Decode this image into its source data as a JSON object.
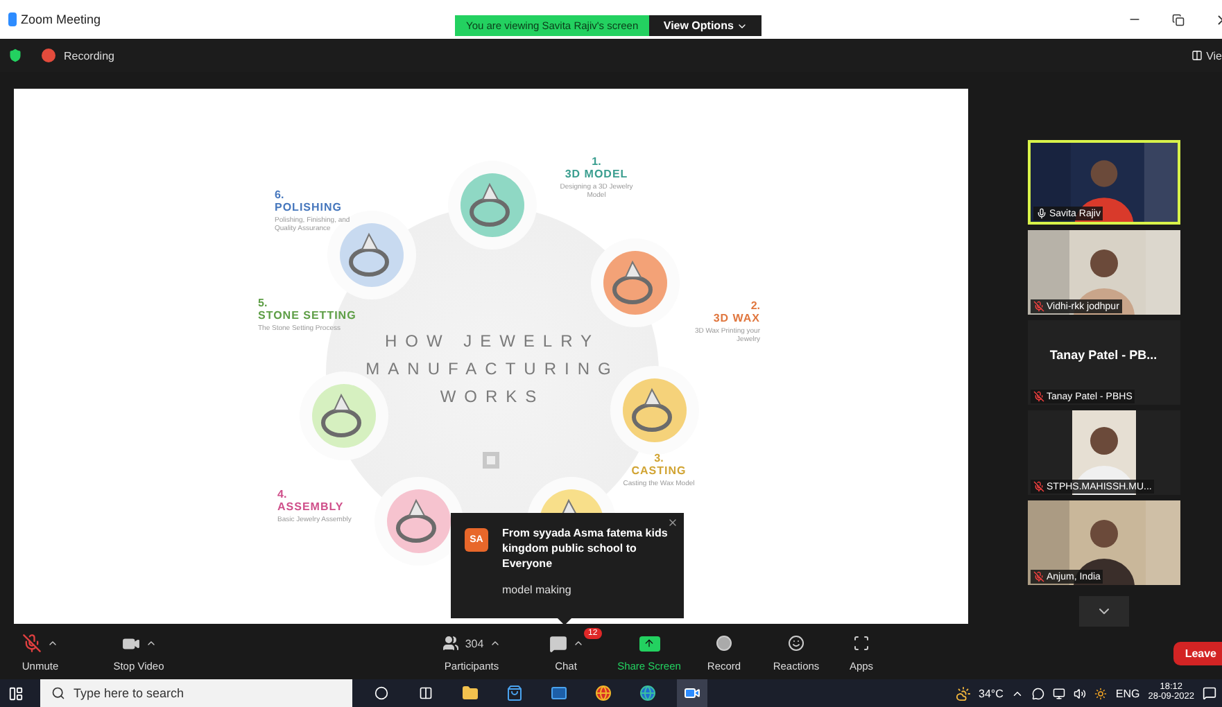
{
  "window": {
    "title": "Zoom Meeting",
    "share_banner": "You are viewing Savita Rajiv's screen",
    "view_options": "View Options"
  },
  "top_bar": {
    "recording": "Recording",
    "view": "Vie"
  },
  "slide": {
    "title_lines": [
      "HOW JEWELRY",
      "MANUFACTURING",
      "WORKS"
    ],
    "steps": [
      {
        "number": "1.",
        "name": "3D MODEL",
        "description": "Designing a 3D Jewelry Model",
        "color": "#3a9e8f"
      },
      {
        "number": "6.",
        "name": "POLISHING",
        "description": "Polishing, Finishing, and Quality Assurance",
        "color": "#4677bd"
      },
      {
        "number": "5.",
        "name": "STONE SETTING",
        "description": "The Stone Setting Process",
        "color": "#5e9e46"
      },
      {
        "number": "2.",
        "name": "3D WAX",
        "description": "3D Wax Printing your Jewelry",
        "color": "#e0763e"
      },
      {
        "number": "3.",
        "name": "CASTING",
        "description": "Casting the Wax Model",
        "color": "#d1a433"
      },
      {
        "number": "4.",
        "name": "ASSEMBLY",
        "description": "Basic Jewelry Assembly",
        "color": "#cf4f8a"
      }
    ]
  },
  "participants": [
    {
      "name": "Savita Rajiv",
      "kind": "video",
      "selected": true,
      "muted": false
    },
    {
      "name": "Vidhi-rkk jodhpur",
      "kind": "video",
      "selected": false,
      "muted": true
    },
    {
      "name": "Tanay Patel - PBHS",
      "title": "Tanay Patel - PB...",
      "kind": "name_only",
      "selected": false,
      "muted": true
    },
    {
      "name": "STPHS.MAHISSH.MU...",
      "kind": "video",
      "selected": false,
      "muted": true
    },
    {
      "name": "Anjum, India",
      "kind": "video",
      "selected": false,
      "muted": true
    }
  ],
  "chat_popup": {
    "avatar": "SA",
    "sender": "From syyada Asma fatema kids kingdom public school to Everyone",
    "message": "model making"
  },
  "toolbar": {
    "audio": {
      "label": "Unmute",
      "muted": true
    },
    "video": {
      "label": "Stop Video"
    },
    "participants": {
      "label": "Participants",
      "count": "304"
    },
    "chat": {
      "label": "Chat",
      "badge": "12"
    },
    "share": {
      "label": "Share Screen"
    },
    "record": {
      "label": "Record"
    },
    "reactions": {
      "label": "Reactions"
    },
    "apps": {
      "label": "Apps"
    },
    "leave": {
      "label": "Leave"
    }
  },
  "taskbar": {
    "search_placeholder": "Type here to search",
    "temperature": "34°C",
    "language": "ENG",
    "time": "18:12",
    "date": "28-09-2022"
  }
}
